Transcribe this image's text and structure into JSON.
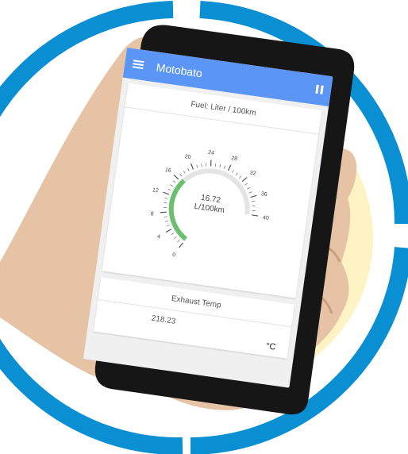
{
  "app": {
    "title": "Motobato"
  },
  "fuel": {
    "header": "Fuel: Liter / 100km",
    "value": "16.72",
    "unit": "L/100km",
    "ticks": [
      "0",
      "4",
      "8",
      "12",
      "16",
      "20",
      "24",
      "28",
      "32",
      "36",
      "40"
    ],
    "level_fraction": 0.418
  },
  "exhaust": {
    "header": "Exhaust Temp",
    "value": "218.23",
    "unit": "°C"
  },
  "colors": {
    "ring_blue": "#0b8fd3",
    "halo_yellow": "#fdf3c4",
    "appbar_blue": "#5b95f5",
    "gauge_green": "#6cbf6e",
    "phone_black": "#161616"
  },
  "icons": [
    "menu-icon",
    "pause-icon"
  ]
}
